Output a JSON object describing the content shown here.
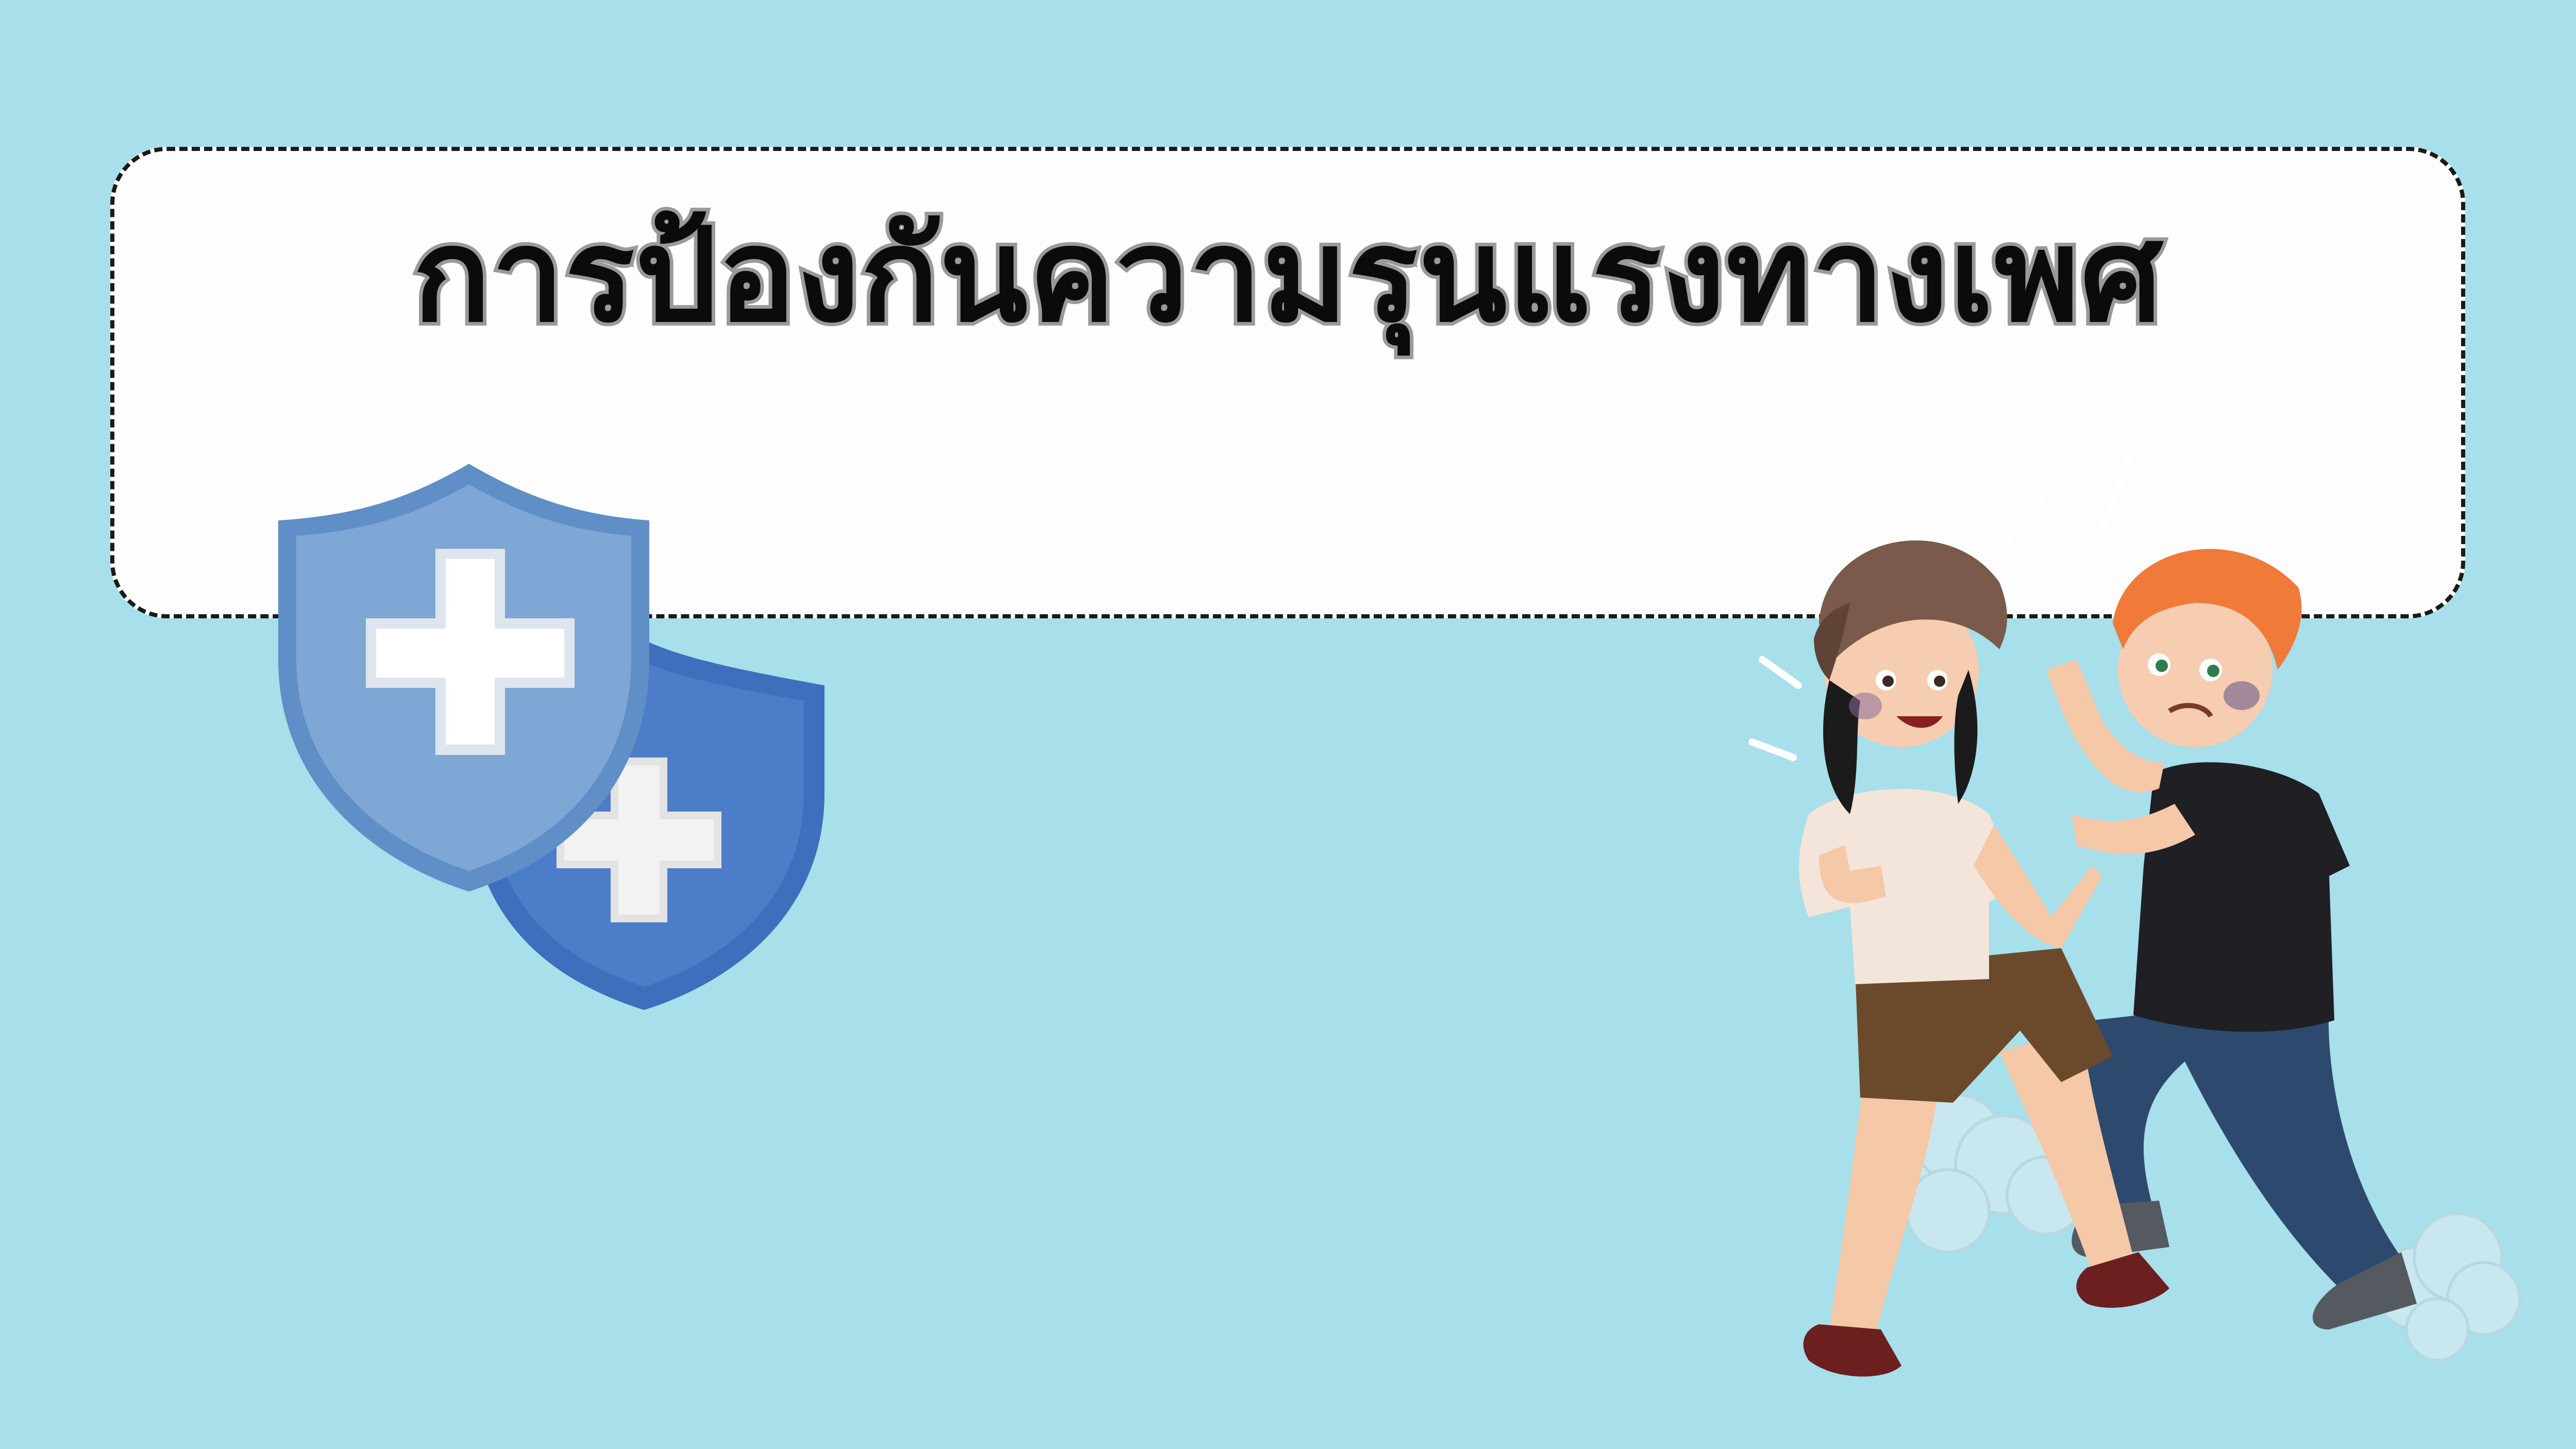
{
  "slide": {
    "title": "การป้องกันความรุนแรงทางเพศ",
    "colors": {
      "background": "#a7dfeb",
      "card": "#fdfdfd",
      "card_border": "#1a1a1a",
      "title_text": "#0b0b0b",
      "title_outline": "#9a9a9a",
      "shield_light": "#7ea7d5",
      "shield_dark": "#3d6fbd"
    }
  },
  "illustrations": {
    "shields_icon": "medical-shield-icon",
    "scene_icon": "two-boys-fighting-illustration"
  }
}
